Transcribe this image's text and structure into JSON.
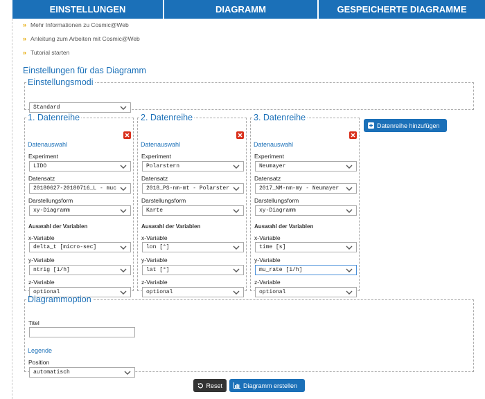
{
  "nav": {
    "tabs": [
      "EINSTELLUNGEN",
      "DIAGRAMM",
      "GESPEICHERTE DIAGRAMME"
    ]
  },
  "links": [
    "Mehr Informationen zu Cosmic@Web",
    "Anleitung zum Arbeiten mit Cosmic@Web",
    "Tutorial starten"
  ],
  "settings": {
    "title": "Einstellungen für das Diagramm",
    "modes": {
      "legend": "Einstellungsmodi",
      "value": "Standard"
    }
  },
  "labels": {
    "datenauswahl": "Datenauswahl",
    "experiment": "Experiment",
    "datensatz": "Datensatz",
    "darstellungsform": "Darstellungsform",
    "auswahl_variablen": "Auswahl der Variablen",
    "x_variable": "x-Variable",
    "y_variable": "y-Variable",
    "z_variable": "z-Variable"
  },
  "series": [
    {
      "title": "1. Datenreihe",
      "experiment": "LIDO",
      "datensatz": "20180627-20180716_L - muc",
      "darstellungsform": "xy-Diagramm",
      "x": "delta_t [micro-sec]",
      "y": "ntrig [1/h]",
      "z": "optional"
    },
    {
      "title": "2. Datenreihe",
      "experiment": "Polarstern",
      "datensatz": "2018_PS-nm-mt - Polarster",
      "darstellungsform": "Karte",
      "x": "lon [°]",
      "y": "lat [°]",
      "z": "optional"
    },
    {
      "title": "3. Datenreihe",
      "experiment": "Neumayer",
      "datensatz": "2017_NM-nm-my - Neumayer",
      "darstellungsform": "xy-Diagramm",
      "x": "time [s]",
      "y": "mu_rate [1/h]",
      "z": "optional"
    }
  ],
  "add_series_button": "Datenreihe hinzufügen",
  "diagram_option": {
    "legend": "Diagrammoption",
    "title_label": "Titel",
    "title_value": "",
    "legend_section": "Legende",
    "position_label": "Position",
    "position_value": "automatisch"
  },
  "actions": {
    "reset": "Reset",
    "create": "Diagramm erstellen"
  },
  "colors": {
    "accent": "#1b70b8",
    "delete": "#d9301c",
    "bullet": "#e6a800"
  }
}
